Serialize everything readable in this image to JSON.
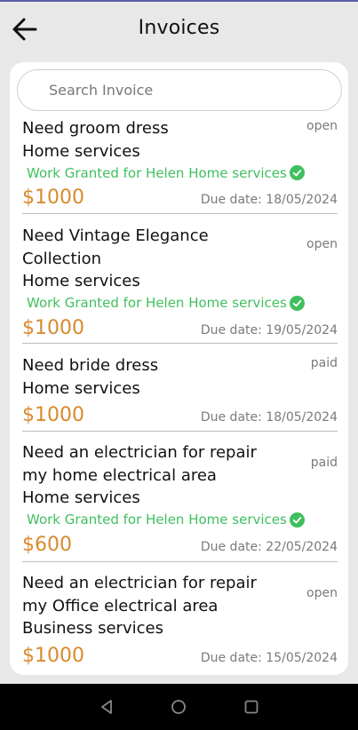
{
  "header": {
    "title": "Invoices"
  },
  "search": {
    "placeholder": "Search Invoice"
  },
  "invoices": [
    {
      "description": "Need groom dress\nHome services",
      "status": "open",
      "granted": "Work Granted for Helen Home services",
      "amount": "$1000",
      "due": "Due date: 18/05/2024"
    },
    {
      "description": "Need Vintage Elegance Collection\nHome services",
      "status": "open",
      "granted": "Work Granted for Helen Home services",
      "amount": "$1000",
      "due": "Due date: 19/05/2024"
    },
    {
      "description": "Need bride dress\nHome services",
      "status": "paid",
      "granted": null,
      "amount": "$1000",
      "due": "Due date: 18/05/2024"
    },
    {
      "description": "Need an electrician for repair my home electrical area\nHome services",
      "status": "paid",
      "granted": "Work Granted for Helen Home services",
      "amount": "$600",
      "due": "Due date: 22/05/2024"
    },
    {
      "description": "Need an electrician for repair my Office electrical area\nBusiness services",
      "status": "open",
      "granted": null,
      "amount": "$1000",
      "due": "Due date: 15/05/2024"
    }
  ],
  "colors": {
    "amount": "#d98a2c",
    "granted": "#3fbf5e",
    "muted": "#7a7a7a"
  },
  "icons": {
    "back": "arrow-left-icon",
    "granted": "check-circle-icon",
    "nav_back": "triangle-back-icon",
    "nav_home": "circle-home-icon",
    "nav_recent": "square-recent-icon"
  }
}
